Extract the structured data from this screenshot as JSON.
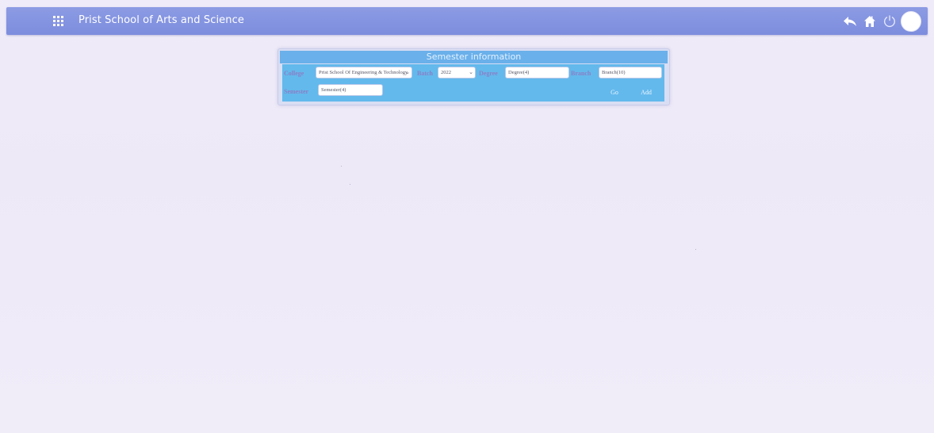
{
  "header": {
    "title": "Prist School of Arts and Science",
    "icons": [
      "apps-grid-icon",
      "back-arrow-icon",
      "home-icon",
      "power-icon",
      "avatar"
    ]
  },
  "panel": {
    "title": "Semester information",
    "fields": {
      "college": {
        "label": "College",
        "value": "Prist School Of Engineering & Technology"
      },
      "batch": {
        "label": "Batch",
        "value": "2022"
      },
      "degree": {
        "label": "Degree",
        "value": "Degree(4)"
      },
      "branch": {
        "label": "Branch",
        "value": "Branch(10)"
      },
      "semester": {
        "label": "Semester",
        "value": "Semester(4)"
      }
    },
    "buttons": {
      "go": "Go",
      "add": "Add"
    }
  },
  "colors": {
    "topbar": "#8290e0",
    "panel_header": "#6ab0ea",
    "panel_body": "#63b9ec",
    "page_background": "#ede9f7"
  }
}
